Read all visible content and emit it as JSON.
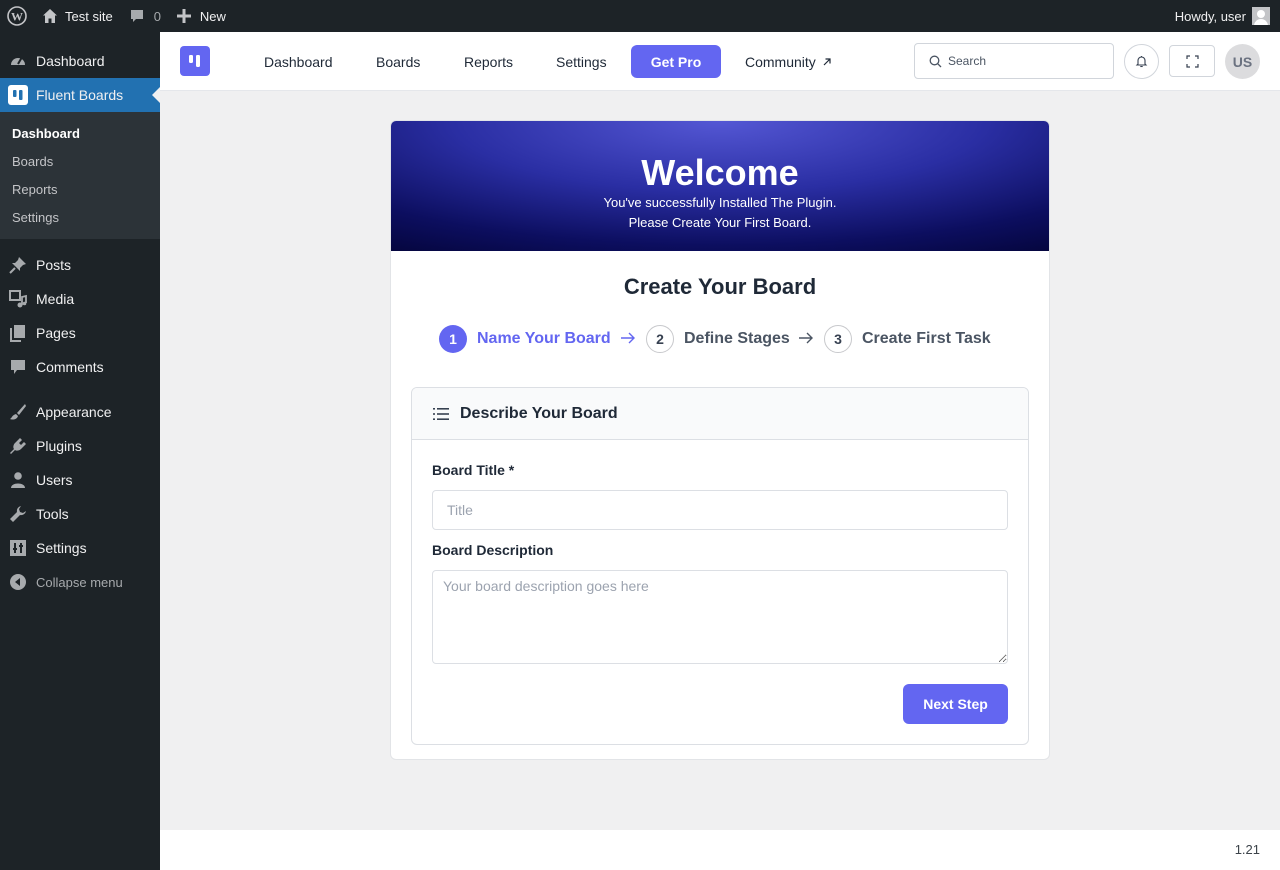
{
  "adminbar": {
    "site_name": "Test site",
    "comments_count": "0",
    "new_label": "New",
    "greeting": "Howdy, user"
  },
  "sidebar": {
    "items_top": [
      {
        "label": "Dashboard",
        "icon": "dashboard-icon"
      },
      {
        "label": "Fluent Boards",
        "icon": "fluent-boards-icon"
      }
    ],
    "submenu": [
      "Dashboard",
      "Boards",
      "Reports",
      "Settings"
    ],
    "items_mid": [
      {
        "label": "Posts",
        "icon": "pin-icon"
      },
      {
        "label": "Media",
        "icon": "media-icon"
      },
      {
        "label": "Pages",
        "icon": "pages-icon"
      },
      {
        "label": "Comments",
        "icon": "comment-icon"
      }
    ],
    "items_low": [
      {
        "label": "Appearance",
        "icon": "brush-icon"
      },
      {
        "label": "Plugins",
        "icon": "plugin-icon"
      },
      {
        "label": "Users",
        "icon": "user-icon"
      },
      {
        "label": "Tools",
        "icon": "wrench-icon"
      },
      {
        "label": "Settings",
        "icon": "settings-icon"
      }
    ],
    "collapse_label": "Collapse menu"
  },
  "topnav": {
    "links": [
      "Dashboard",
      "Boards",
      "Reports",
      "Settings"
    ],
    "pro_label": "Get Pro",
    "community_label": "Community",
    "search_placeholder": "Search",
    "avatar_initials": "US"
  },
  "welcome": {
    "title": "Welcome",
    "line1": "You've successfully Installed The Plugin.",
    "line2": "Please Create Your First Board."
  },
  "create": {
    "title": "Create Your Board",
    "steps": [
      {
        "num": "1",
        "label": "Name Your Board"
      },
      {
        "num": "2",
        "label": "Define Stages"
      },
      {
        "num": "3",
        "label": "Create First Task"
      }
    ]
  },
  "form": {
    "section_title": "Describe Your Board",
    "title_label": "Board Title *",
    "title_placeholder": "Title",
    "desc_label": "Board Description",
    "desc_placeholder": "Your board description goes here",
    "next_label": "Next Step"
  },
  "footer": {
    "version": "1.21"
  },
  "colors": {
    "accent": "#6366f1",
    "wp_dark": "#1d2327",
    "wp_blue": "#2271b1"
  }
}
